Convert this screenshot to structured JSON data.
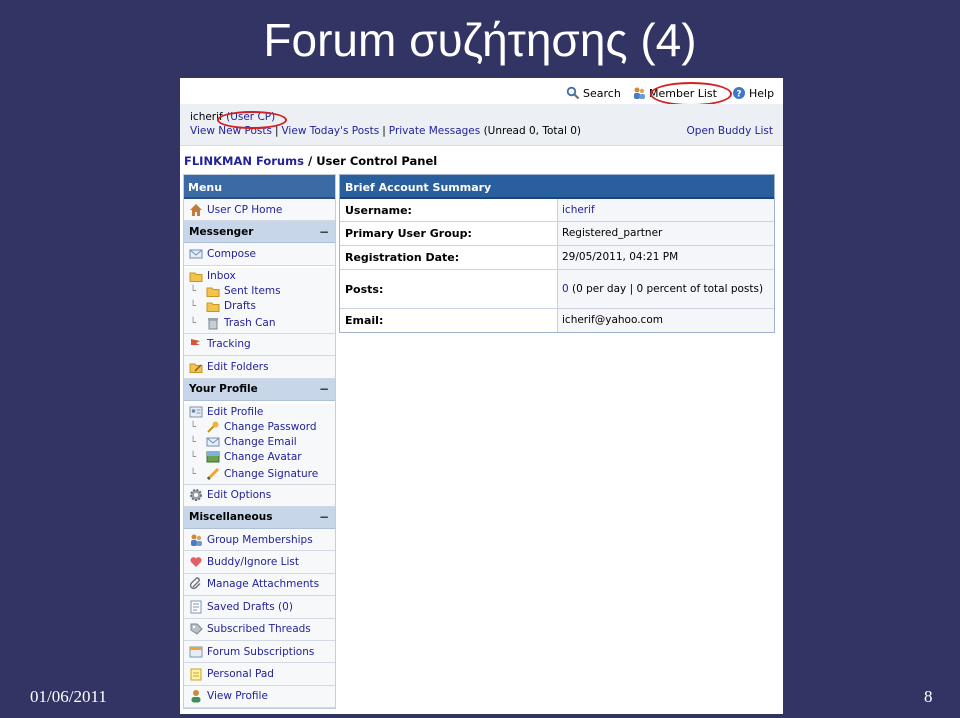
{
  "slide": {
    "title": "Forum συζήτησης (4)",
    "date": "01/06/2011",
    "number": "8"
  },
  "topnav": {
    "search": "Search",
    "member_list": "Member List",
    "help": "Help"
  },
  "userbar": {
    "username": "icherif",
    "user_cp": "(User CP)",
    "links": [
      "View New Posts",
      "View Today's Posts",
      "Private Messages"
    ],
    "unread_text": "(Unread 0, Total 0)",
    "buddy_list": "Open Buddy List"
  },
  "breadcrumb": {
    "forum": "FLINKMAN Forums",
    "separator": "/",
    "page": "User Control Panel"
  },
  "menu": {
    "title": "Menu",
    "home": "User CP Home",
    "messenger": {
      "title": "Messenger",
      "compose": "Compose",
      "inbox": "Inbox",
      "sent": "Sent Items",
      "drafts": "Drafts",
      "trash": "Trash Can",
      "tracking": "Tracking",
      "folders": "Edit Folders"
    },
    "profile": {
      "title": "Your Profile",
      "edit_profile": "Edit Profile",
      "change_password": "Change Password",
      "change_email": "Change Email",
      "change_avatar": "Change Avatar",
      "change_signature": "Change Signature",
      "edit_options": "Edit Options"
    },
    "misc": {
      "title": "Miscellaneous",
      "groups": "Group Memberships",
      "buddy": "Buddy/Ignore List",
      "attachments": "Manage Attachments",
      "saved_drafts": "Saved Drafts (0)",
      "subscribed": "Subscribed Threads",
      "forum_subs": "Forum Subscriptions",
      "pad": "Personal Pad",
      "view_profile": "View Profile"
    }
  },
  "summary": {
    "title": "Brief Account Summary",
    "rows": [
      {
        "label": "Username:",
        "value": "icherif"
      },
      {
        "label": "Primary User Group:",
        "value": "Registered_partner"
      },
      {
        "label": "Registration Date:",
        "value": "29/05/2011, 04:21 PM"
      },
      {
        "label": "Posts:",
        "value_link": "0",
        "value": "(0 per day | 0 percent of total posts)"
      },
      {
        "label": "Email:",
        "value": "icherif@yahoo.com"
      }
    ]
  },
  "colors": {
    "slide_bg": "#323463",
    "header_blue": "#2a5f9e",
    "section_blue": "#c8d6ea",
    "link": "#22229c",
    "highlight_red": "#d42020"
  }
}
